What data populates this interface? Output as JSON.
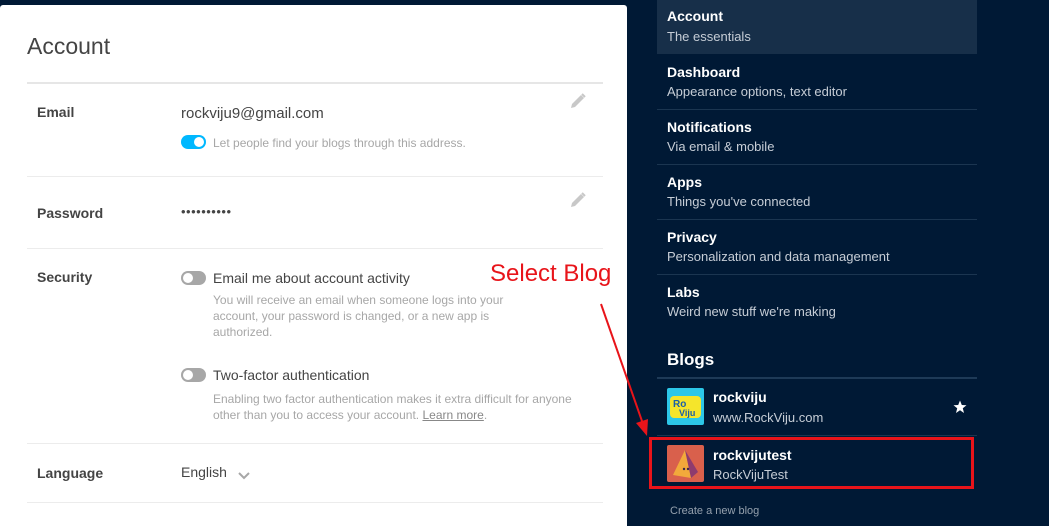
{
  "account": {
    "title": "Account",
    "email": {
      "label": "Email",
      "value": "rockviju9@gmail.com",
      "toggle_label": "Let people find your blogs through this address."
    },
    "password": {
      "label": "Password",
      "value": "••••••••••"
    },
    "security": {
      "label": "Security",
      "email_activity_label": "Email me about account activity",
      "email_activity_help": "You will receive an email when someone logs into your account, your password is changed, or a new app is authorized.",
      "two_factor_label": "Two-factor authentication",
      "two_factor_help": "Enabling two factor authentication makes it extra difficult for anyone other than you to access your account.",
      "learn_more": "Learn more",
      "period": "."
    },
    "language": {
      "label": "Language",
      "value": "English"
    }
  },
  "sidebar": {
    "items": [
      {
        "title": "Account",
        "subtitle": "The essentials"
      },
      {
        "title": "Dashboard",
        "subtitle": "Appearance options, text editor"
      },
      {
        "title": "Notifications",
        "subtitle": "Via email & mobile"
      },
      {
        "title": "Apps",
        "subtitle": "Things you've connected"
      },
      {
        "title": "Privacy",
        "subtitle": "Personalization and data management"
      },
      {
        "title": "Labs",
        "subtitle": "Weird new stuff we're making"
      }
    ],
    "blogs_heading": "Blogs",
    "blogs": [
      {
        "name": "rockviju",
        "url": "www.RockViju.com"
      },
      {
        "name": "rockvijutest",
        "url": "RockVijuTest"
      }
    ],
    "create_blog": "Create a new blog"
  },
  "annotation": {
    "text": "Select Blog",
    "color": "#e8141a"
  },
  "colors": {
    "background": "#001935",
    "toggle_on": "#00b8ff",
    "toggle_off": "#a7a7a7"
  }
}
